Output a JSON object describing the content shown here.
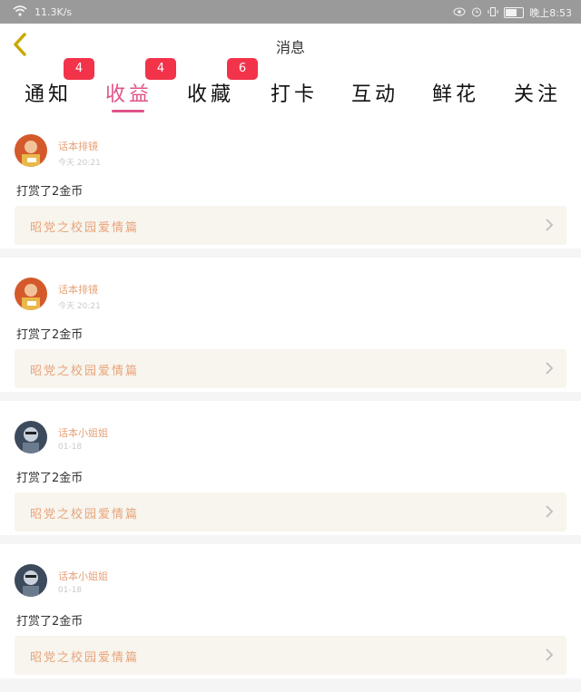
{
  "status_bar": {
    "network_speed": "11.3K/s",
    "time": "晚上8:53"
  },
  "header": {
    "title": "消息"
  },
  "tabs": [
    {
      "label": "通知",
      "badge": "4"
    },
    {
      "label": "收益",
      "badge": "4",
      "active": true
    },
    {
      "label": "收藏",
      "badge": "6"
    },
    {
      "label": "打卡"
    },
    {
      "label": "互动"
    },
    {
      "label": "鲜花"
    },
    {
      "label": "关注"
    }
  ],
  "feed": [
    {
      "user": "话本排镜",
      "time": "今天 20:21",
      "action": "打赏了2金币",
      "work": "昭党之校园爱情篇"
    },
    {
      "user": "话本排镜",
      "time": "今天 20:21",
      "action": "打赏了2金币",
      "work": "昭党之校园爱情篇"
    },
    {
      "user": "话本小姐姐",
      "time": "01-18",
      "action": "打赏了2金币",
      "work": "昭党之校园爱情篇"
    },
    {
      "user": "话本小姐姐",
      "time": "01-18",
      "action": "打赏了2金币",
      "work": "昭党之校园爱情篇"
    }
  ],
  "colors": {
    "accent": "#e0538a",
    "badge": "#f2334a",
    "username": "#e8a27a",
    "ref_bg": "#f7f5ee"
  }
}
